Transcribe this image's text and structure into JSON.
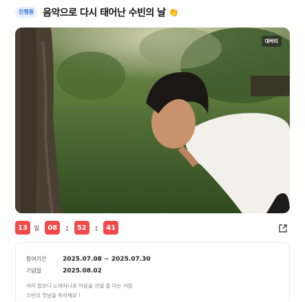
{
  "header": {
    "status": "진행중",
    "title": "음악으로 다시 태어난 수빈의 날",
    "emoji": "👏"
  },
  "hero": {
    "tag": "대버리"
  },
  "countdown": {
    "days": "13",
    "day_unit": "일",
    "hours": "08",
    "minutes": "52",
    "seconds": "41",
    "separator": ":"
  },
  "info": {
    "period_label": "참여기간",
    "period_value": "2025.07.08 ~ 2025.07.30",
    "anniversary_label": "기념일",
    "anniversary_value": "2025.08.02",
    "description_line1": "여러 말보다 노래하나로 마음을 건넬 줄 아는 사람",
    "description_line2": "수빈의 첫날을 축하해요 !"
  },
  "colors": {
    "countdown_red": "#f04a4a",
    "badge_bg": "#e8f0fe",
    "badge_text": "#3b6fd8"
  }
}
